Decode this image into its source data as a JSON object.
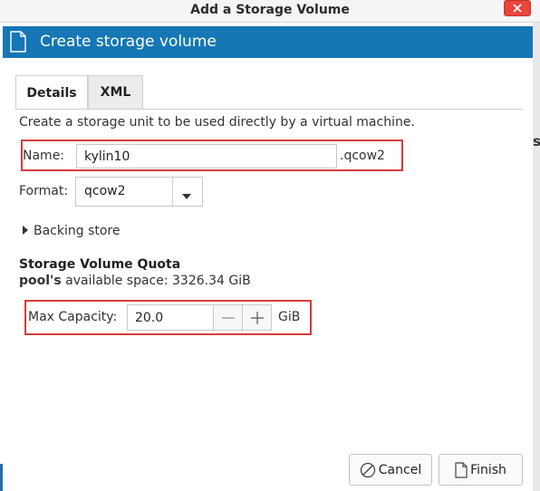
{
  "window": {
    "title": "Add a Storage Volume"
  },
  "header": {
    "title": "Create storage volume",
    "icon": "page-icon"
  },
  "tabs": [
    {
      "label": "Details",
      "active": true
    },
    {
      "label": "XML",
      "active": false
    }
  ],
  "description": "Create a storage unit to be used directly by a virtual machine.",
  "name_field": {
    "label": "Name:",
    "value": "kylin10",
    "suffix": ".qcow2"
  },
  "format_field": {
    "label": "Format:",
    "value": "qcow2"
  },
  "backing_store": {
    "label": "Backing store"
  },
  "quota": {
    "title": "Storage Volume Quota",
    "pool_name": "pool's",
    "available_text": "available space: 3326.34 GiB"
  },
  "capacity": {
    "label": "Max Capacity:",
    "value": "20.0",
    "unit": "GiB"
  },
  "buttons": {
    "cancel": "Cancel",
    "finish": "Finish"
  },
  "background": {
    "letter": "s"
  },
  "colors": {
    "header": "#1577b5",
    "highlight": "#d83b3b",
    "close": "#e9453d"
  }
}
